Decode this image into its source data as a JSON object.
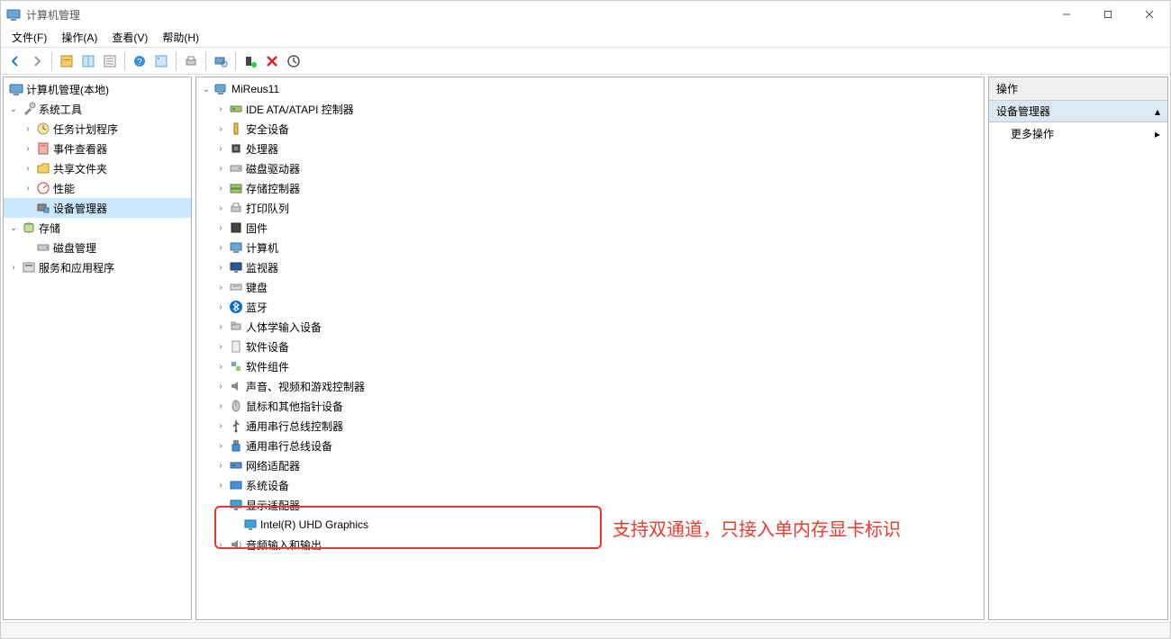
{
  "window": {
    "title": "计算机管理"
  },
  "menu": [
    "文件(F)",
    "操作(A)",
    "查看(V)",
    "帮助(H)"
  ],
  "left_tree": {
    "root": "计算机管理(本地)",
    "groups": [
      {
        "label": "系统工具",
        "expanded": true,
        "children": [
          {
            "label": "任务计划程序"
          },
          {
            "label": "事件查看器"
          },
          {
            "label": "共享文件夹"
          },
          {
            "label": "性能"
          },
          {
            "label": "设备管理器",
            "selected": true
          }
        ]
      },
      {
        "label": "存储",
        "expanded": true,
        "children": [
          {
            "label": "磁盘管理"
          }
        ]
      },
      {
        "label": "服务和应用程序",
        "expanded": false
      }
    ]
  },
  "device_tree": {
    "root": "MiReus11",
    "categories": [
      {
        "label": "IDE ATA/ATAPI 控制器"
      },
      {
        "label": "安全设备"
      },
      {
        "label": "处理器"
      },
      {
        "label": "磁盘驱动器"
      },
      {
        "label": "存储控制器"
      },
      {
        "label": "打印队列"
      },
      {
        "label": "固件"
      },
      {
        "label": "计算机"
      },
      {
        "label": "监视器"
      },
      {
        "label": "键盘"
      },
      {
        "label": "蓝牙"
      },
      {
        "label": "人体学输入设备"
      },
      {
        "label": "软件设备"
      },
      {
        "label": "软件组件"
      },
      {
        "label": "声音、视频和游戏控制器"
      },
      {
        "label": "鼠标和其他指针设备"
      },
      {
        "label": "通用串行总线控制器"
      },
      {
        "label": "通用串行总线设备"
      },
      {
        "label": "网络适配器"
      },
      {
        "label": "系统设备"
      },
      {
        "label": "显示适配器",
        "expanded": true,
        "children": [
          {
            "label": "Intel(R) UHD Graphics"
          }
        ]
      },
      {
        "label": "音频输入和输出"
      }
    ]
  },
  "actions": {
    "header": "操作",
    "section": "设备管理器",
    "item": "更多操作"
  },
  "annotation": "支持双通道，只接入单内存显卡标识"
}
